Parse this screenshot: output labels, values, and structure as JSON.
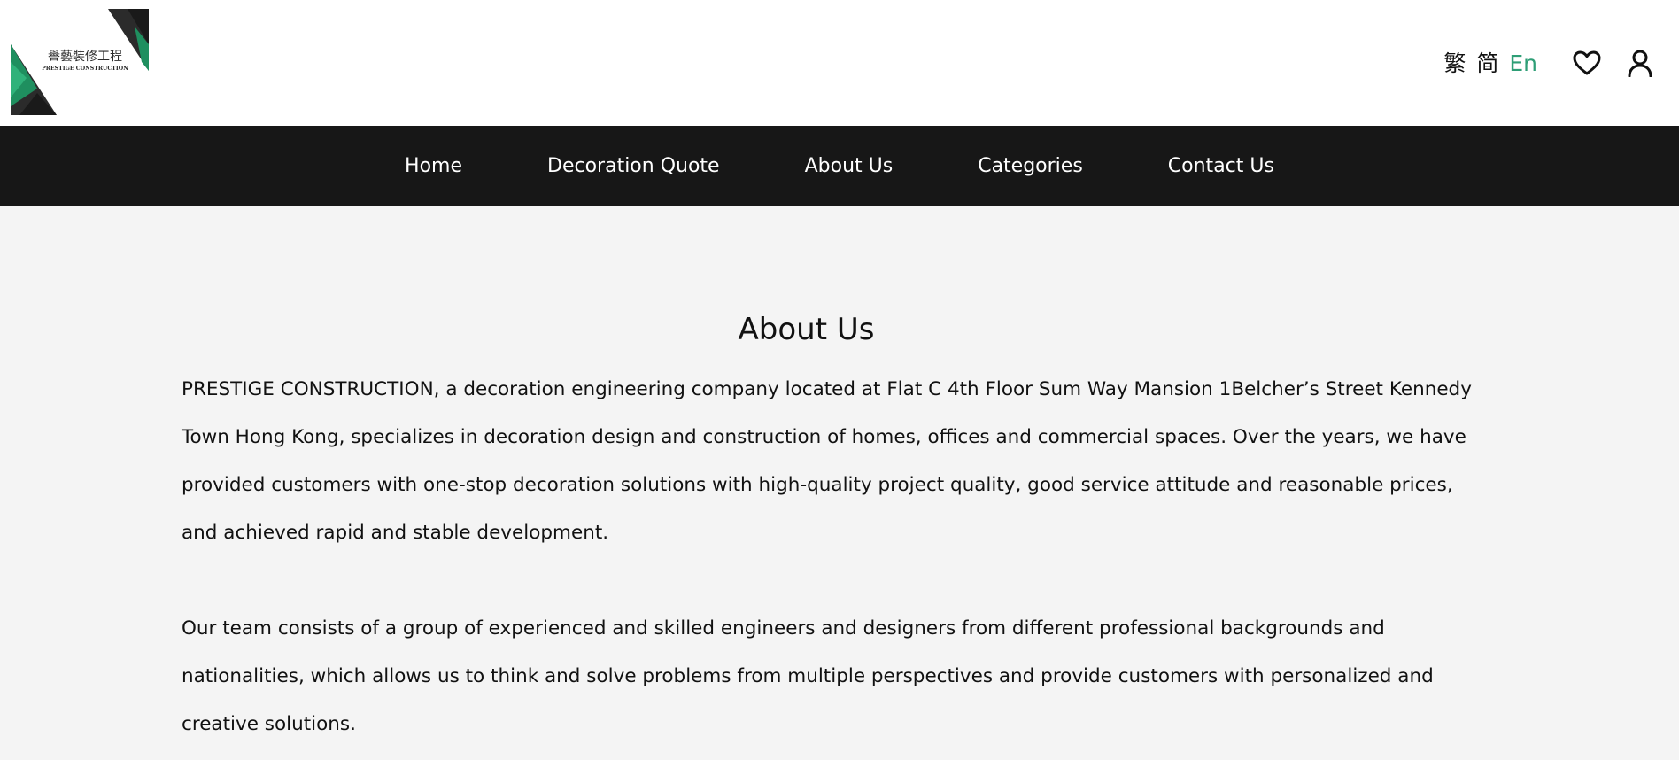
{
  "header": {
    "logo": {
      "name_cn": "譽藝裝修工程",
      "name_en": "PRESTIGE CONSTRUCTION",
      "colors": {
        "green": "#1f8f5f",
        "dark": "#2a2a2a"
      }
    },
    "languages": [
      {
        "label": "繁",
        "active": false
      },
      {
        "label": "简",
        "active": false
      },
      {
        "label": "En",
        "active": true
      }
    ],
    "icons": [
      "heart-icon",
      "user-icon"
    ]
  },
  "nav": {
    "items": [
      {
        "label": "Home"
      },
      {
        "label": "Decoration Quote"
      },
      {
        "label": "About Us"
      },
      {
        "label": "Categories"
      },
      {
        "label": "Contact Us"
      }
    ]
  },
  "main": {
    "title": "About Us",
    "paragraphs": [
      "PRESTIGE CONSTRUCTION, a decoration engineering company located at Flat C 4th Floor Sum Way Mansion 1Belcher’s Street Kennedy Town Hong Kong, specializes in decoration design and construction of homes, offices and commercial spaces. Over the years, we have provided customers with one-stop decoration solutions with high-quality project quality, good service attitude and reasonable prices, and achieved rapid and stable development.",
      "Our team consists of a group of experienced and skilled engineers and designers from different professional backgrounds and nationalities, which allows us to think and solve problems from multiple perspectives and provide customers with personalized and creative solutions."
    ]
  },
  "colors": {
    "accent": "#2e9e76",
    "nav_bg": "#171717",
    "page_bg": "#f4f4f4"
  }
}
